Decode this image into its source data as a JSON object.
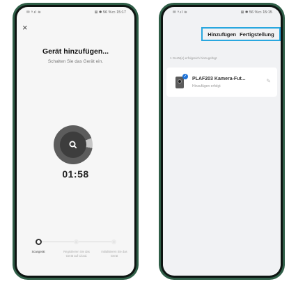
{
  "screen1": {
    "status_left": "✉ ᵃ.ıl ≋",
    "status_right": "⊠ ✱ 56 %▭ 15:17",
    "close_glyph": "×",
    "title": "Gerät hinzufügen...",
    "subtitle": "Schalten Sie das Gerät ein.",
    "timer": "01:58",
    "steps": [
      {
        "label": "Scangerät",
        "state": "active"
      },
      {
        "label": "Registrieren Sie das Gerät auf Cloud.",
        "state": "idle"
      },
      {
        "label": "Initialisieren Sie das Gerät",
        "state": "idle"
      }
    ],
    "icons": {
      "scan": "search-icon",
      "close": "close-icon"
    },
    "colors": {
      "scan_ring": "#5c5c5c",
      "scan_center": "#3d3d3d"
    }
  },
  "screen2": {
    "status_left": "✉ ᵃ.ıl ≋",
    "status_right": "⊠ ✱ 56 %▭ 15:15",
    "header_add": "Hinzufügen",
    "header_finish": "Fertigstellung",
    "found_text": "1 Gerät(e) erfolgreich hinzugefügt",
    "device": {
      "name": "PLAF203 Kamera-Fut...",
      "status": "Hinzufügen erfolgt"
    },
    "icons": {
      "device": "camera-feeder-icon",
      "check": "check-badge-icon",
      "edit": "pencil-icon"
    },
    "colors": {
      "highlight": "#29a7df",
      "check_badge": "#1e73d8"
    }
  },
  "frame_color": "#2f5e47"
}
